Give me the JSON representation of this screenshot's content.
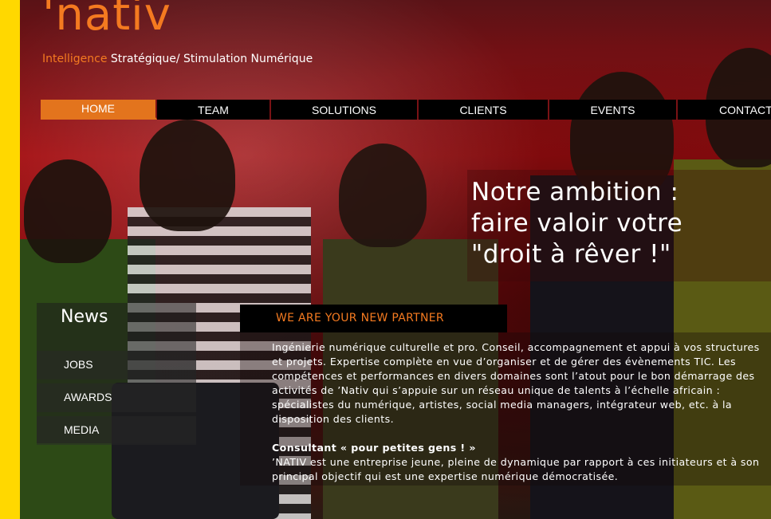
{
  "brand": {
    "logo": "'nativ",
    "tagline_accent": "Intelligence",
    "tagline_rest": " Stratégique/ Stimulation Numérique"
  },
  "nav": {
    "items": [
      {
        "label": "HOME"
      },
      {
        "label": "TEAM"
      },
      {
        "label": "SOLUTIONS"
      },
      {
        "label": "CLIENTS"
      },
      {
        "label": "EVENTS"
      },
      {
        "label": "CONTACT"
      }
    ],
    "active": "HOME"
  },
  "hero": {
    "line1": "Notre ambition :",
    "line2": "faire valoir votre",
    "line3": "\"droit à rêver !\""
  },
  "news": {
    "title": "News",
    "links": [
      "JOBS",
      "AWARDS",
      "MEDIA"
    ]
  },
  "partner": {
    "title": "WE ARE YOUR NEW PARTNER",
    "paragraph1": "Ingénierie numérique culturelle et pro. Conseil, accompagnement et appui à vos structures et projets. Expertise complète en vue d’organiser et de gérer des évènements TIC. Les compétences et performances en divers domaines sont l’atout pour le bon démarrage des activités de ’Nativ qui s’appuie sur un réseau unique de talents à l’échelle africain : spécialistes du numérique, artistes, social media managers, intégrateur web, etc. à la disposition des clients.",
    "subheading": "Consultant « pour petites gens ! »",
    "paragraph2": "’NATIV est une entreprise jeune, pleine de dynamique par rapport à ces initiateurs et à son principal objectif qui est une expertise numérique démocratisée."
  },
  "colors": {
    "accent": "#f47a20",
    "strip": "#ffd800",
    "nav_bg": "#000000",
    "nav_active": "#e3741d"
  }
}
